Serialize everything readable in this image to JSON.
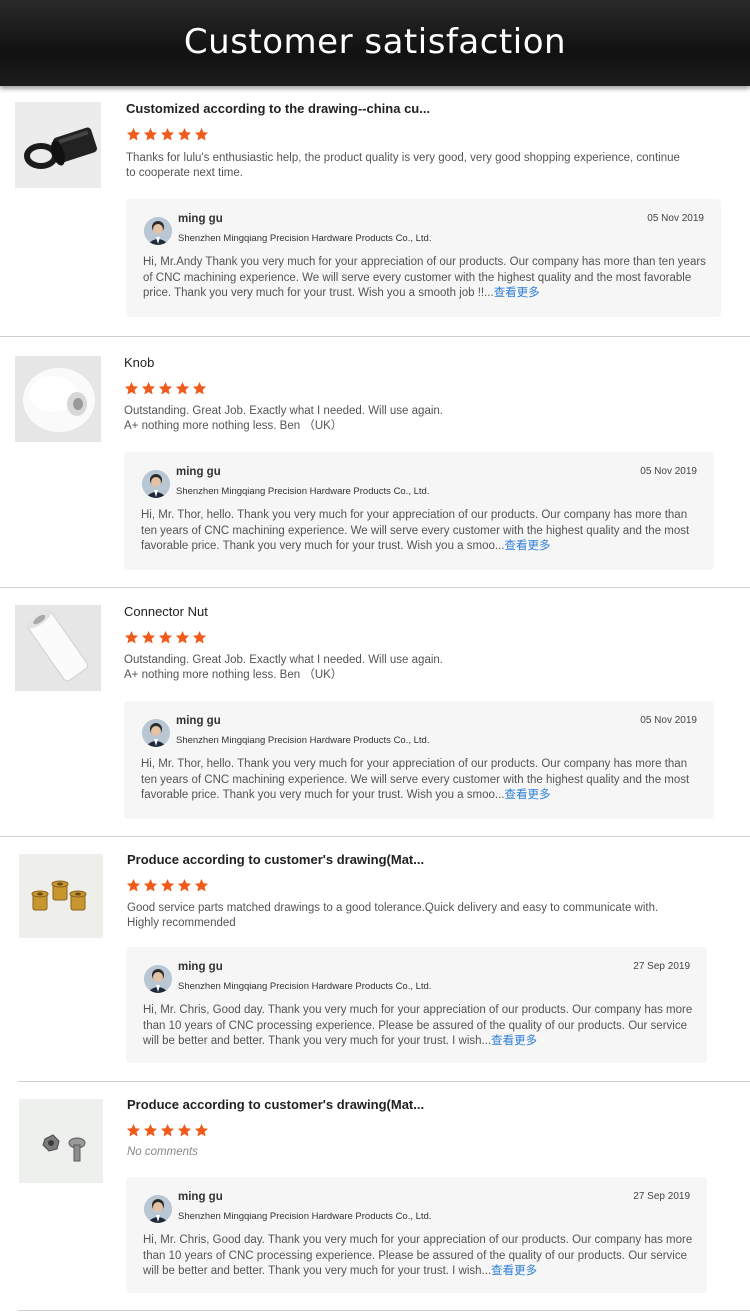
{
  "page": {
    "title": "Customer satisfaction"
  },
  "colors": {
    "star": "#f05a1a",
    "link": "#2f7fd8",
    "banner": "#151515"
  },
  "reviews": [
    {
      "product": "Customized according to the drawing--china cu...",
      "image_icon": "black-bushing-icon",
      "rating": 5,
      "comment": "Thanks for lulu's enthusiastic help, the product quality is very good, very good shopping experience, continue to cooperate next time.",
      "reply": {
        "name": "ming gu",
        "company": "Shenzhen Mingqiang Precision Hardware Products Co., Ltd.",
        "date": "05 Nov 2019",
        "text": "Hi, Mr.Andy Thank you very much for your appreciation of our products. Our company has more than ten years of CNC machining experience. We will serve every customer with the highest quality and the most favorable price. Thank you very much for your trust. Wish you a smooth job !!...",
        "more": "查看更多"
      }
    },
    {
      "product": "Knob",
      "image_icon": "white-knob-icon",
      "rating": 5,
      "comment": "Outstanding.  Great Job.  Exactly what I needed.   Will use again.\nA+  nothing more nothing less.  Ben （UK）",
      "reply": {
        "name": "ming gu",
        "company": "Shenzhen Mingqiang Precision Hardware Products Co., Ltd.",
        "date": "05 Nov 2019",
        "text": "Hi, Mr. Thor, hello. Thank you very much for your appreciation of our products. Our company has more than ten years of CNC machining experience. We will serve every customer with the highest quality and the most favorable price. Thank you very much for your trust. Wish you a smoo...",
        "more": "查看更多"
      }
    },
    {
      "product": "Connector Nut",
      "image_icon": "white-connector-nut-icon",
      "rating": 5,
      "comment": "Outstanding.  Great Job.  Exactly what I needed.   Will use again.\nA+  nothing more nothing less.  Ben （UK）",
      "reply": {
        "name": "ming gu",
        "company": "Shenzhen Mingqiang Precision Hardware Products Co., Ltd.",
        "date": "05 Nov 2019",
        "text": "Hi, Mr. Thor, hello. Thank you very much for your appreciation of our products. Our company has more than ten years of CNC machining experience. We will serve every customer with the highest quality and the most favorable price. Thank you very much for your trust. Wish you a smoo...",
        "more": "查看更多"
      }
    },
    {
      "product": "Produce according to customer's drawing(Mat...",
      "image_icon": "brass-inserts-icon",
      "rating": 5,
      "comment": "Good service parts matched drawings to a good tolerance.Quick delivery and easy to communicate with. Highly recommended",
      "reply": {
        "name": "ming gu",
        "company": "Shenzhen Mingqiang Precision Hardware Products Co., Ltd.",
        "date": "27 Sep 2019",
        "text": "Hi, Mr. Chris, Good day. Thank you very much for your appreciation of our products. Our company has more than 10 years of CNC processing experience. Please be assured of the quality of our products. Our service will be better and better. Thank you very much for your trust. I wish...",
        "more": "查看更多"
      }
    },
    {
      "product": "Produce according to customer's drawing(Mat...",
      "image_icon": "steel-nut-bolt-icon",
      "rating": 5,
      "comment": "No comments",
      "reply": {
        "name": "ming gu",
        "company": "Shenzhen Mingqiang Precision Hardware Products Co., Ltd.",
        "date": "27 Sep 2019",
        "text": "Hi, Mr. Chris, Good day. Thank you very much for your appreciation of our products. Our company has more than 10 years of CNC processing experience. Please be assured of the quality of our products. Our service will be better and better. Thank you very much for your trust. I wish...",
        "more": "查看更多"
      }
    }
  ]
}
